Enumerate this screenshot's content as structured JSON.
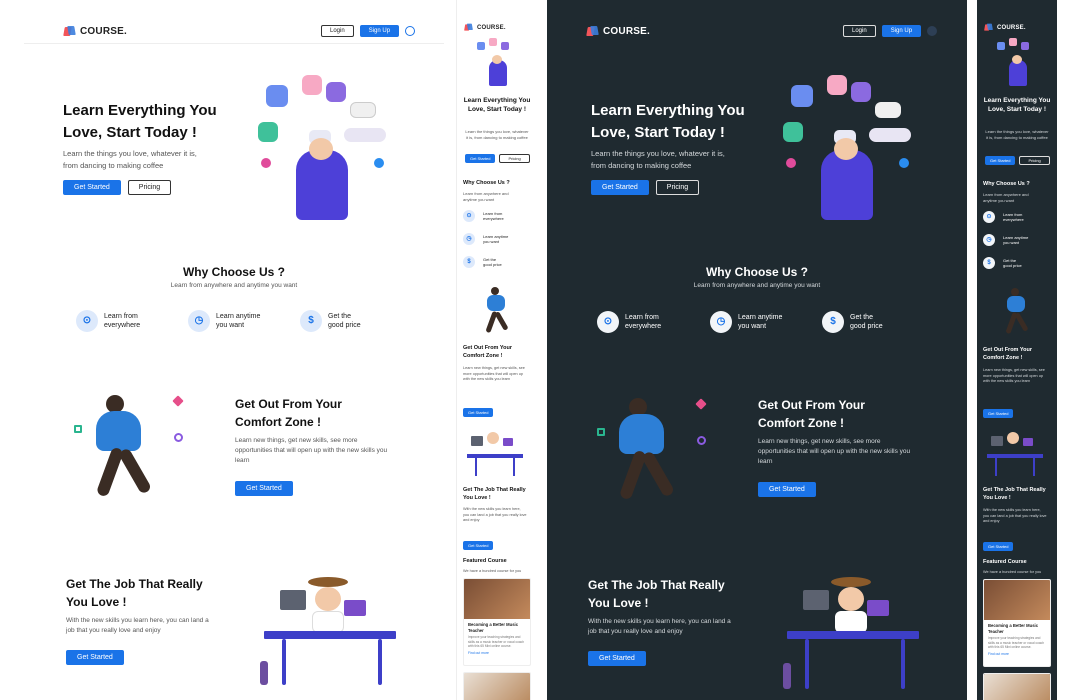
{
  "brand": {
    "name": "COURSE."
  },
  "nav": {
    "login": "Login",
    "signup": "Sign Up"
  },
  "hero": {
    "title_line1": "Learn Everything You",
    "title_line2": "Love, Start Today !",
    "subtitle_line1": "Learn the things you love, whatever it is,",
    "subtitle_line2": "from dancing to making coffee",
    "cta_primary": "Get Started",
    "cta_secondary": "Pricing"
  },
  "why": {
    "title": "Why Choose Us ?",
    "subtitle": "Learn from anywhere and anytime you want",
    "features": [
      {
        "icon": "location-pin-icon",
        "line1": "Learn from",
        "line2": "everywhere"
      },
      {
        "icon": "clock-icon",
        "line1": "Learn anytime",
        "line2": "you want"
      },
      {
        "icon": "dollar-icon",
        "line1": "Get the",
        "line2": "good price"
      }
    ]
  },
  "comfort": {
    "title_line1": "Get Out From Your",
    "title_line2": "Comfort Zone !",
    "text_line1": "Learn new things, get new skills, see more",
    "text_line2": "opportunities that will open up with the new skills you",
    "text_line3": "learn",
    "cta": "Get Started"
  },
  "job": {
    "title_line1": "Get The Job That Really",
    "title_line2": "You Love !",
    "text_line1": "With the new skills you learn here, you can land a",
    "text_line2": "job that you really love and enjoy",
    "cta": "Get Started"
  },
  "mobile": {
    "hero_title": "Learn Everything You Love, Start Today !",
    "hero_text": "Learn the things you love, whatever it is, from dancing to making coffee",
    "why_title": "Why Choose Us ?",
    "why_text": "Learn from anywhere and anytime you want",
    "comfort_title": "Get Out From Your Comfort Zone !",
    "comfort_text": "Learn new things, get new skills, see more opportunities that will open up with the new skills you learn",
    "job_title": "Get The Job That Really You Love !",
    "job_text": "With the new skills you learn here, you can land a job that you really love and enjoy",
    "featured_title": "Featured Course",
    "featured_text": "We have a hundred course for you",
    "course_title": "Becoming a Better Music Teacher",
    "course_text": "Improve your teaching strategies and skills as a music teacher or vocal coach with this 65 Mini online course.",
    "course_link": "Find out more"
  },
  "colors": {
    "primary": "#1a73e8",
    "dark_bg": "#1f2a30",
    "hero_figure": "#4d40d8"
  }
}
